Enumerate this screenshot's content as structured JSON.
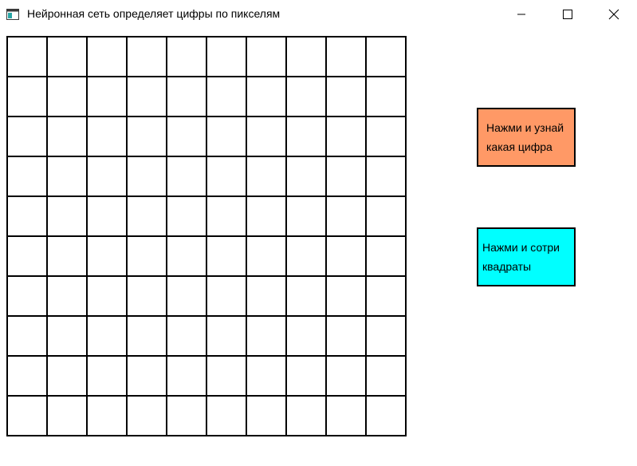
{
  "window": {
    "title": "Нейронная сеть определяет цифры по пикселям",
    "icon": "window-app-icon"
  },
  "grid": {
    "rows": 10,
    "cols": 10
  },
  "buttons": {
    "recognize": {
      "line1": "Нажми и узнай",
      "line2": "какая цифра",
      "color": "#FF9966"
    },
    "clear": {
      "line1": "Нажми и сотри",
      "line2": "квадраты",
      "color": "#00FFFF"
    }
  },
  "colors": {
    "grid_line": "#000000",
    "cell_fill": "#FFFFFF"
  }
}
